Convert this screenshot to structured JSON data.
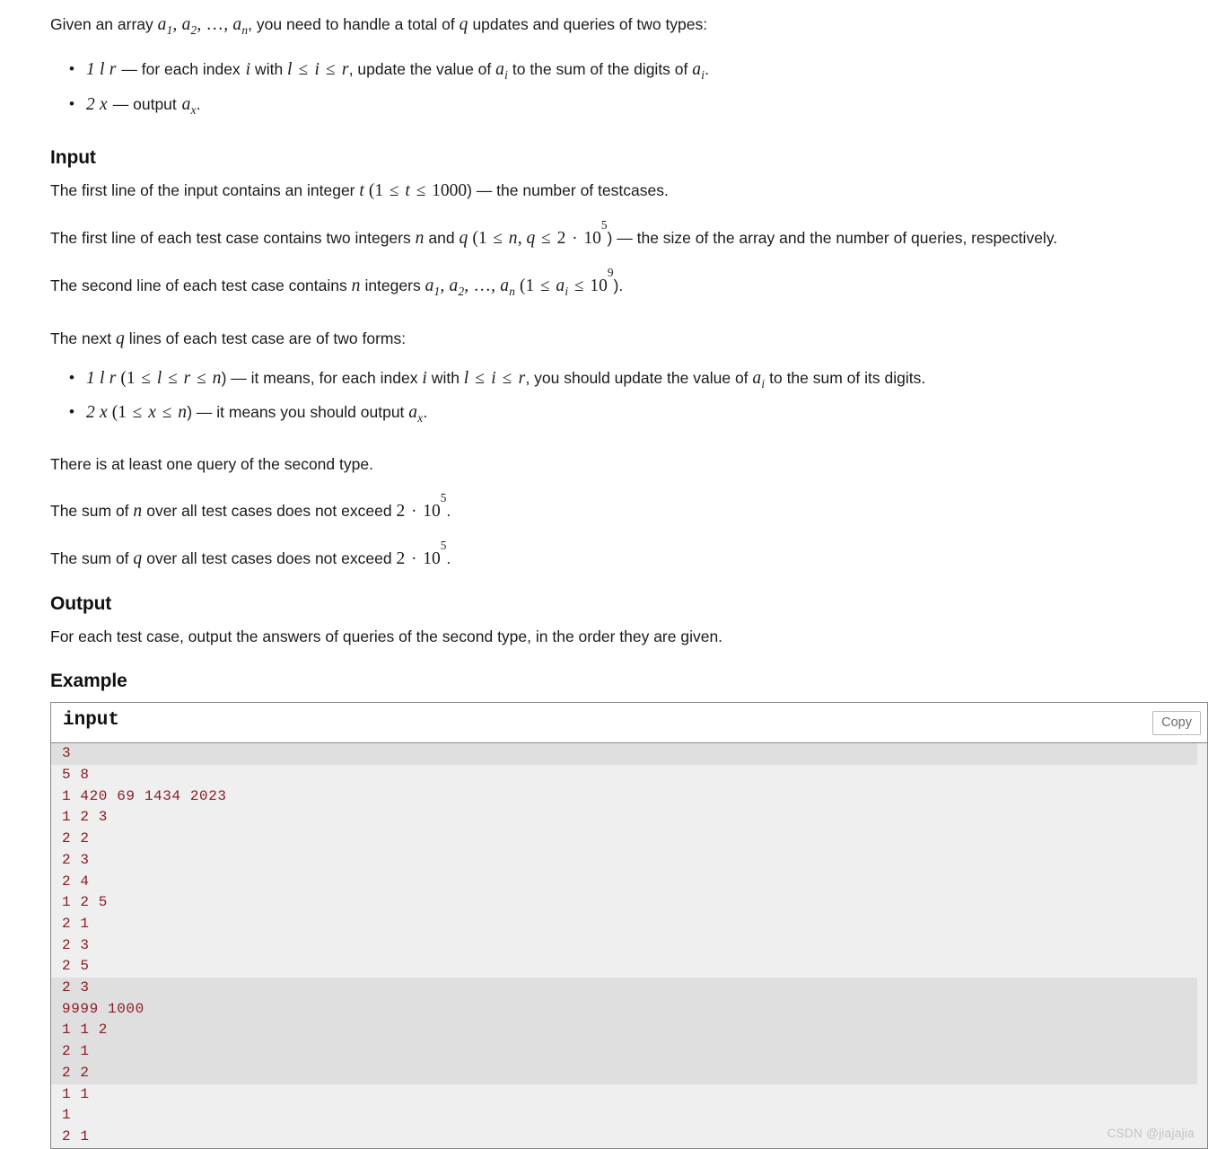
{
  "statement": {
    "intro_prefix": "Given an array ",
    "intro_math_array": "a1, a2, …, an",
    "intro_middle": ", you need to handle a total of ",
    "intro_math_q": "q",
    "intro_suffix": " updates and queries of two types:",
    "bullets": [
      {
        "math_head": "1 l r",
        "text_1": " — for each index ",
        "math_i": "i",
        "text_2": " with ",
        "math_range": "l ≤ i ≤ r",
        "text_3": ", update the value of ",
        "math_ai": "ai",
        "text_4": " to the sum of the digits of ",
        "math_ai2": "ai",
        "text_5": "."
      },
      {
        "math_head": "2 x",
        "text_1": " — output ",
        "math_ax": "ax",
        "text_2": "."
      }
    ]
  },
  "input_section": {
    "heading": "Input",
    "p1": {
      "t1": "The first line of the input contains an integer ",
      "m1": "t",
      "t2": " (",
      "m2": "1 ≤ t ≤ 1000",
      "t3": ") — the number of testcases."
    },
    "p2": {
      "t1": "The first line of each test case contains two integers ",
      "m1": "n",
      "t2": " and ",
      "m2": "q",
      "t3": " (",
      "m3": "1 ≤ n, q ≤ 2 · 10^5",
      "t4": ") — the size of the array and the number of queries, respectively."
    },
    "p3": {
      "t1": "The second line of each test case contains ",
      "m1": "n",
      "t2": " integers ",
      "m2": "a1, a2, …, an",
      "t3": " (",
      "m3": "1 ≤ ai ≤ 10^9",
      "t4": ")."
    },
    "p4": {
      "t1": "The next ",
      "m1": "q",
      "t2": " lines of each test case are of two forms:"
    },
    "bullets": [
      {
        "math_head": "1 l r",
        "t1": " (",
        "math_cond": "1 ≤ l ≤ r ≤ n",
        "t2": ") — it means, for each index ",
        "math_i": "i",
        "t3": " with ",
        "math_range": "l ≤ i ≤ r",
        "t4": ", you should update the value of ",
        "math_ai": "ai",
        "t5": " to the sum of its digits."
      },
      {
        "math_head": "2 x",
        "t1": " (",
        "math_cond": "1 ≤ x ≤ n",
        "t2": ") — it means you should output ",
        "math_ax": "ax",
        "t3": "."
      }
    ],
    "p5": "There is at least one query of the second type.",
    "p6": {
      "t1": "The sum of ",
      "m1": "n",
      "t2": " over all test cases does not exceed ",
      "m2": "2 · 10^5",
      "t3": "."
    },
    "p7": {
      "t1": "The sum of ",
      "m1": "q",
      "t2": " over all test cases does not exceed ",
      "m2": "2 · 10^5",
      "t3": "."
    }
  },
  "output_section": {
    "heading": "Output",
    "p1": "For each test case, output the answers of queries of the second type, in the order they are given."
  },
  "example_section": {
    "heading": "Example",
    "sample_title": "input",
    "copy_label": "Copy",
    "code_groups": [
      {
        "shaded": true,
        "lines": [
          "3"
        ]
      },
      {
        "shaded": false,
        "lines": [
          "5 8",
          "1 420 69 1434 2023",
          "1 2 3",
          "2 2",
          "2 3",
          "2 4",
          "1 2 5",
          "2 1",
          "2 3",
          "2 5"
        ]
      },
      {
        "shaded": true,
        "lines": [
          "2 3",
          "9999 1000",
          "1 1 2",
          "2 1",
          "2 2"
        ]
      },
      {
        "shaded": false,
        "lines": [
          "1 1",
          "1",
          "2 1"
        ]
      }
    ]
  },
  "watermark": "CSDN @jiajajia",
  "colors": {
    "code_text": "#8b1c24",
    "code_bg_light": "#efefef",
    "code_bg_shaded": "#dfdfdf",
    "border": "#888888",
    "body_text": "#1b1b1b",
    "watermark": "#c3c3c3"
  }
}
